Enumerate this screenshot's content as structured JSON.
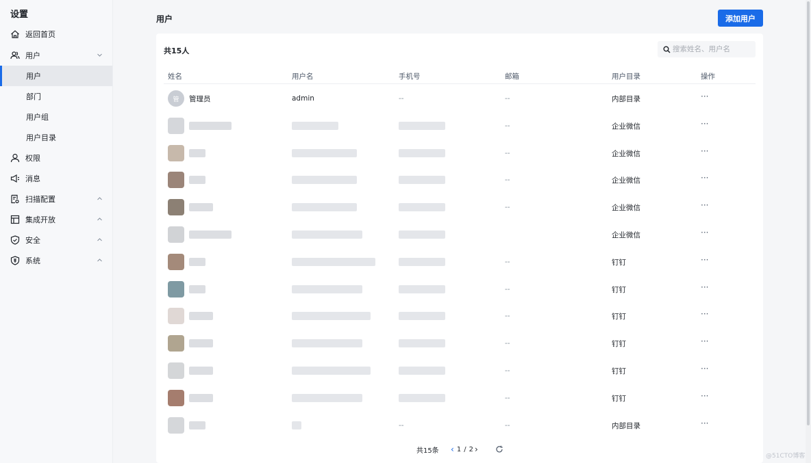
{
  "sidebar": {
    "title": "设置",
    "items": [
      {
        "label": "返回首页",
        "icon": "home-icon"
      },
      {
        "label": "用户",
        "icon": "users-icon",
        "expanded": true
      },
      {
        "label": "用户",
        "sub": true,
        "active": true
      },
      {
        "label": "部门",
        "sub": true
      },
      {
        "label": "用户组",
        "sub": true
      },
      {
        "label": "用户目录",
        "sub": true
      },
      {
        "label": "权限",
        "icon": "person-icon"
      },
      {
        "label": "消息",
        "icon": "megaphone-icon"
      },
      {
        "label": "扫描配置",
        "icon": "scan-config-icon",
        "expanded": false
      },
      {
        "label": "集成开放",
        "icon": "layout-icon",
        "expanded": false
      },
      {
        "label": "安全",
        "icon": "shield-check-icon",
        "expanded": false
      },
      {
        "label": "系统",
        "icon": "shield-badge-icon",
        "expanded": false
      }
    ]
  },
  "main": {
    "title": "用户",
    "add_button": "添加用户",
    "count": "共15人",
    "search_placeholder": "搜索姓名、用户名",
    "columns": [
      "姓名",
      "用户名",
      "手机号",
      "邮箱",
      "用户目录",
      "操作"
    ],
    "rows": [
      {
        "name": "管理员",
        "avatar_char": "管",
        "username": "admin",
        "phone": "--",
        "email": "--",
        "directory": "内部目录",
        "action": "···"
      },
      {
        "name": "",
        "username": "",
        "phone": "",
        "email": "--",
        "directory": "企业微信",
        "action": "···"
      },
      {
        "name": "",
        "username": "",
        "phone": "",
        "email": "--",
        "directory": "企业微信",
        "action": "···"
      },
      {
        "name": "",
        "username": "",
        "phone": "",
        "email": "--",
        "directory": "企业微信",
        "action": "···"
      },
      {
        "name": "",
        "username": "",
        "phone": "",
        "email": "--",
        "directory": "企业微信",
        "action": "···"
      },
      {
        "name": "",
        "username": "",
        "phone": "",
        "email": "",
        "directory": "企业微信",
        "action": "···"
      },
      {
        "name": "",
        "username": "",
        "phone": "",
        "email": "--",
        "directory": "钉钉",
        "action": "···"
      },
      {
        "name": "",
        "username": "",
        "phone": "",
        "email": "--",
        "directory": "钉钉",
        "action": "···"
      },
      {
        "name": "",
        "username": "",
        "phone": "",
        "email": "--",
        "directory": "钉钉",
        "action": "···"
      },
      {
        "name": "",
        "username": "",
        "phone": "",
        "email": "--",
        "directory": "钉钉",
        "action": "···"
      },
      {
        "name": "",
        "username": "",
        "phone": "",
        "email": "--",
        "directory": "钉钉",
        "action": "···"
      },
      {
        "name": "",
        "username": "",
        "phone": "",
        "email": "--",
        "directory": "钉钉",
        "action": "···"
      },
      {
        "name": "",
        "username": "",
        "phone": "--",
        "email": "--",
        "directory": "内部目录",
        "action": "···"
      }
    ],
    "pagination": {
      "total": "共15条",
      "current": "1",
      "separator": "/",
      "pages": "2"
    }
  },
  "watermark": "@51CTO博客",
  "colors": {
    "accent": "#1a6be8",
    "sidebar_bg": "#f7f8fa",
    "active_bg": "#e6e8ec"
  }
}
